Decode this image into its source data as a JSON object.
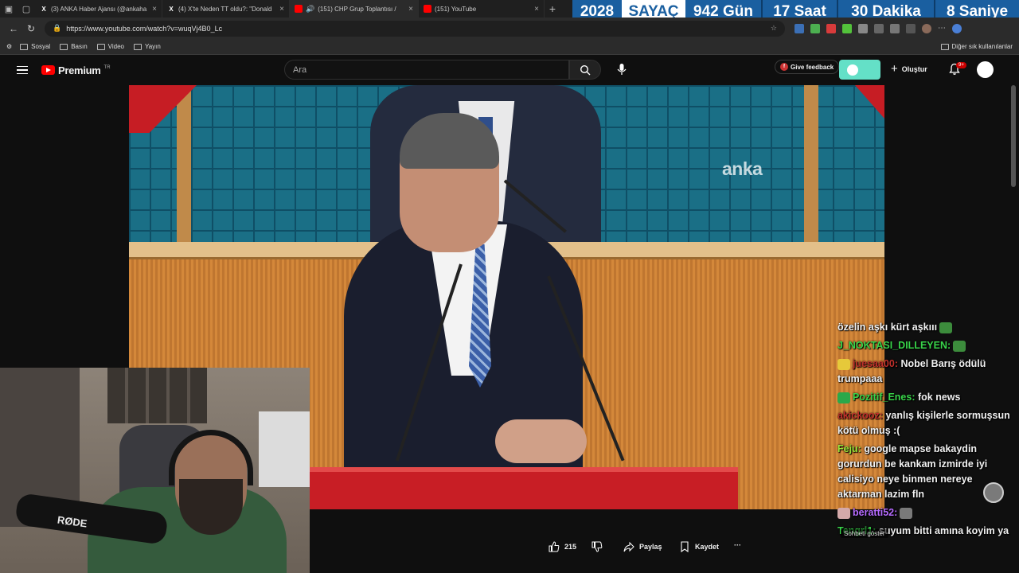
{
  "browser": {
    "tabs": [
      {
        "title": "(3) ANKA Haber Ajansı (@ankaha",
        "favicon": "X",
        "color": "#000000"
      },
      {
        "title": "(4) X'te Neden TT oldu?: \"Donald",
        "favicon": "X",
        "color": "#000000"
      },
      {
        "title": "(151) CHP Grup Toplantısı / ",
        "favicon": "yt",
        "color": "#ff0000",
        "active": true
      },
      {
        "title": "(151) YouTube",
        "favicon": "yt",
        "color": "#ff0000"
      }
    ],
    "url": "https://www.youtube.com/watch?v=wuqVj4B0_Lc",
    "bookmarks": [
      "Sosyal",
      "Basın",
      "Video",
      "Yayın"
    ],
    "bookmarks_other": "Diğer sık kullanılanlar"
  },
  "countdown": {
    "year": "2028",
    "label": "SAYAÇ",
    "days": "942 Gün",
    "hours": "17 Saat",
    "minutes": "30 Dakika",
    "seconds": "8 Saniye"
  },
  "youtube": {
    "logo_text": "Premium",
    "logo_region": "TR",
    "search_placeholder": "Ara",
    "feedback_label": "Give feedback",
    "create_label": "Oluştur",
    "notifications_badge": "9+",
    "video_watermark": "anka",
    "actions": {
      "likes": "215",
      "share": "Paylaş",
      "save": "Kaydet",
      "more": "···"
    }
  },
  "webcam": {
    "mic_brand": "RØDE"
  },
  "chat": {
    "messages": [
      {
        "user": "",
        "user_color": "#ffffff",
        "text": "özelin aşkı kürt aşkııı",
        "emote": "#3c8c3c"
      },
      {
        "user": "J_NOKTASI_DILLEYEN:",
        "user_color": "#39d44a",
        "text": "",
        "emote": "#3c8c3c"
      },
      {
        "user": "juesaa00:",
        "user_color": "#c0302b",
        "text": "Nobel Barış ödülü trumpaaa",
        "emote_before": "#e6c93a"
      },
      {
        "user": "Pozitif_Enes:",
        "user_color": "#39d44a",
        "text": "fok news",
        "emote_before": "#2aa84a"
      },
      {
        "user": "akickooz:",
        "user_color": "#c0302b",
        "text": "yanlış kişilerle sormuşsun kötü olmuş :("
      },
      {
        "user": "Feju:",
        "user_color": "#9be63a",
        "text": "google mapse bakaydin gorurdun be kankam izmirde iyi calisiyo neye binmen nereye aktarman lazim fln"
      },
      {
        "user": "beratti52:",
        "user_color": "#b66bff",
        "text": "",
        "emote": "#7a7a7a",
        "emote_before": "#d4a9a9"
      },
      {
        "user": "Tengri1:",
        "user_color": "#39d44a",
        "text": "suyum bitti amına koyim ya"
      }
    ],
    "tooltip": "Sohbeti göster"
  }
}
